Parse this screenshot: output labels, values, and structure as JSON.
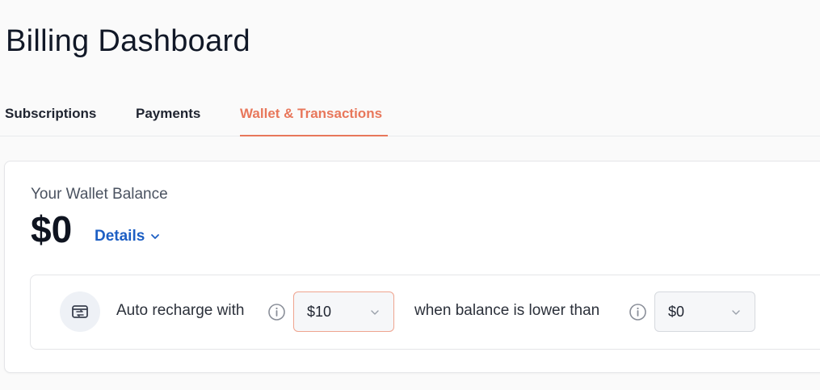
{
  "page": {
    "title": "Billing Dashboard"
  },
  "tabs": [
    {
      "label": "Subscriptions",
      "active": false
    },
    {
      "label": "Payments",
      "active": false
    },
    {
      "label": "Wallet & Transactions",
      "active": true
    }
  ],
  "wallet": {
    "balance_label": "Your Wallet Balance",
    "balance_amount": "$0",
    "details_label": "Details",
    "details_icon": "chevron-down-icon"
  },
  "auto_recharge": {
    "icon": "recharge-icon",
    "label": "Auto recharge with",
    "amount_value": "$10",
    "threshold_label": "when balance is lower than",
    "threshold_value": "$0",
    "info_icon": "info-icon"
  },
  "colors": {
    "accent": "#e8775b",
    "link": "#1d5fc4",
    "text": "#1f2430"
  }
}
